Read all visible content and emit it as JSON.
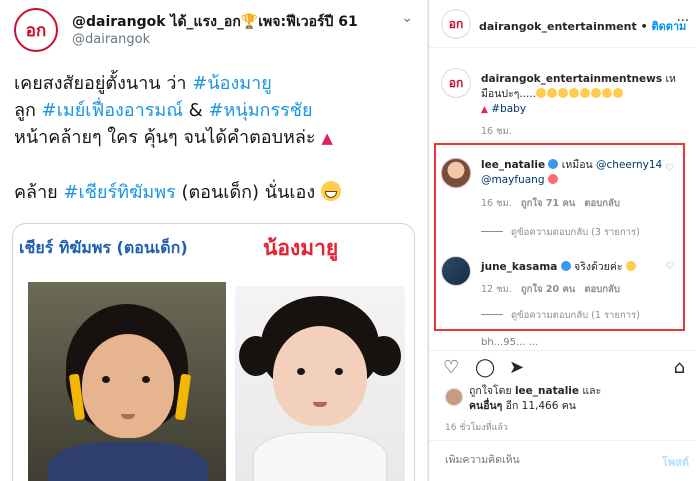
{
  "tweet": {
    "avatar_text": "อก",
    "name": "@dairangok ได้_แรง_อก🏆เพจ:ฟีเวอร์ปี 61",
    "handle": "@dairangok",
    "chevron": "⌄",
    "line1_pre": "เคยสงสัยอยู่ตั้งนาน ว่า ",
    "line1_tag": "#น้องมายู",
    "line2_pre": "ลูก ",
    "line2_tag1": "#เมย์เฟื่องอารมณ์",
    "line2_mid": " & ",
    "line2_tag2": "#หนุ่มกรรชัย",
    "line3": "หน้าคล้ายๆ ใคร คุ้นๆ จนได้คำตอบหล่ะ ",
    "line3_icon": "▲",
    "line4_pre": "คล้าย ",
    "line4_tag": "#เชียร์ทิฆัมพร",
    "line4_post": "  (ตอนเด็ก) นั่นเอง ",
    "image": {
      "caption_left": "เชียร์ ทิฆัมพร (ตอนเด็ก)",
      "caption_right": "น้องมายู"
    }
  },
  "instagram": {
    "header": {
      "avatar_text": "อก",
      "username": "dairangok_entertainment",
      "separator": " • ",
      "follow": "ติดตาม",
      "more": "···"
    },
    "caption": {
      "avatar_text": "อก",
      "username": "dairangok_entertainmentnews",
      "text": " เหมือนปะๆ.....",
      "tag": "#baby",
      "time": "16 ชม."
    },
    "comments": [
      {
        "username": "lee_natalie",
        "text": " เหมือน ",
        "mention1": "@cheerny14",
        "mention2": "@mayfuang",
        "time": "16 ชม.",
        "likes": "ถูกใจ 71 คน",
        "reply": "ตอบกลับ",
        "view_replies": "ดูข้อความตอบกลับ (3 รายการ)"
      },
      {
        "username": "june_kasama",
        "text": " จริงด้วยค่ะ ",
        "time": "12 ชม.",
        "likes": "ถูกใจ 20 คน",
        "reply": "ตอบกลับ",
        "view_replies": "ดูข้อความตอบกลับ (1 รายการ)"
      }
    ],
    "faded_comment": "bh...95... ...",
    "likes": {
      "prefix": "ถูกใจโดย ",
      "user": "lee_natalie",
      "and": " และ",
      "others_label": "คนอื่นๆ",
      "others_count": " อีก 11,466 คน"
    },
    "time_ago": "16 ชั่วโมงที่แล้ว",
    "comment_placeholder": "เพิ่มความคิดเห็น",
    "post_button": "โพสต์",
    "icons": {
      "like": "♡",
      "comment": "◯",
      "share": "➤",
      "save": "⌂"
    }
  }
}
